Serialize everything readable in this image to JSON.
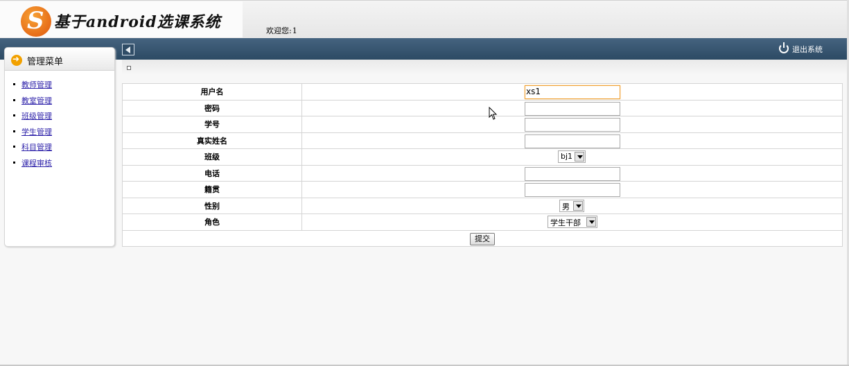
{
  "header": {
    "logo_letter": "S",
    "title": "基于android选课系统",
    "welcome_label": "欢迎您:",
    "welcome_name": "1"
  },
  "toolbar": {
    "logout_label": "退出系统"
  },
  "sidebar": {
    "title": "管理菜单",
    "items": [
      {
        "label": "教师管理"
      },
      {
        "label": "教室管理"
      },
      {
        "label": "班级管理"
      },
      {
        "label": "学生管理"
      },
      {
        "label": "科目管理"
      },
      {
        "label": "课程审核"
      }
    ]
  },
  "form": {
    "fields": [
      {
        "label": "用户名",
        "value": "xs1"
      },
      {
        "label": "密码",
        "value": ""
      },
      {
        "label": "学号",
        "value": ""
      },
      {
        "label": "真实姓名",
        "value": ""
      },
      {
        "label": "班级",
        "value": "bj1"
      },
      {
        "label": "电话",
        "value": ""
      },
      {
        "label": "籍贯",
        "value": ""
      },
      {
        "label": "性别",
        "value": "男"
      },
      {
        "label": "角色",
        "value": "学生干部"
      }
    ],
    "submit_label": "提交"
  },
  "icons": {
    "logo": "logo-icon",
    "menu": "arrow-right-circle-icon",
    "collapse": "collapse-left-icon",
    "logout": "power-icon",
    "cursor": "mouse-cursor-icon"
  },
  "colors": {
    "toolbar": "#34536e",
    "menu_icon": "#f2a100",
    "link": "#2a1ea8",
    "focus_border": "#f0a030"
  }
}
